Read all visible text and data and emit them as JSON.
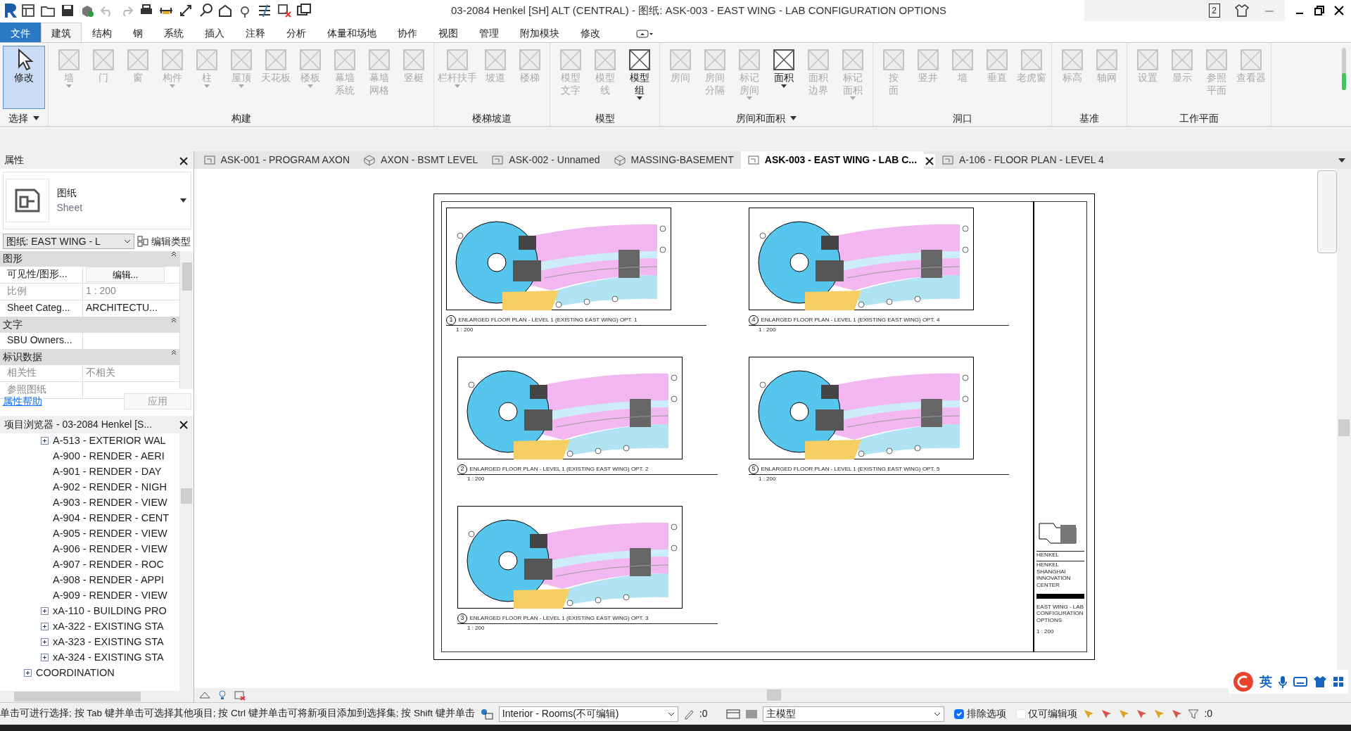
{
  "title_bar": {
    "title": "03-2084 Henkel [SH] ALT (CENTRAL) - 图纸: ASK-003 - EAST WING - LAB CONFIGURATION OPTIONS",
    "badge": "2"
  },
  "ribbon_tabs": [
    {
      "label": "文件",
      "kind": "file",
      "selected": false
    },
    {
      "label": "建筑",
      "kind": "tab",
      "selected": true
    },
    {
      "label": "结构",
      "kind": "tab",
      "selected": false
    },
    {
      "label": "钢",
      "kind": "tab",
      "selected": false
    },
    {
      "label": "系统",
      "kind": "tab",
      "selected": false
    },
    {
      "label": "插入",
      "kind": "tab",
      "selected": false
    },
    {
      "label": "注释",
      "kind": "tab",
      "selected": false
    },
    {
      "label": "分析",
      "kind": "tab",
      "selected": false
    },
    {
      "label": "体量和场地",
      "kind": "tab",
      "selected": false
    },
    {
      "label": "协作",
      "kind": "tab",
      "selected": false
    },
    {
      "label": "视图",
      "kind": "tab",
      "selected": false
    },
    {
      "label": "管理",
      "kind": "tab",
      "selected": false
    },
    {
      "label": "附加模块",
      "kind": "tab",
      "selected": false
    },
    {
      "label": "修改",
      "kind": "tab",
      "selected": false
    }
  ],
  "ribbon_panels": [
    {
      "label": "选择",
      "menu": true,
      "tools": [
        {
          "label": "修改",
          "wrapped": false,
          "disabled": false,
          "selected": true,
          "dropdown": false
        }
      ]
    },
    {
      "label": "构建",
      "menu": false,
      "tools": [
        {
          "label": "墙",
          "wrapped": false,
          "disabled": true,
          "selected": false,
          "dropdown": true
        },
        {
          "label": "门",
          "wrapped": false,
          "disabled": true,
          "selected": false,
          "dropdown": false
        },
        {
          "label": "窗",
          "wrapped": false,
          "disabled": true,
          "selected": false,
          "dropdown": false
        },
        {
          "label": "构件",
          "wrapped": false,
          "disabled": true,
          "selected": false,
          "dropdown": true
        },
        {
          "label": "柱",
          "wrapped": false,
          "disabled": true,
          "selected": false,
          "dropdown": true
        },
        {
          "label": "屋顶",
          "wrapped": false,
          "disabled": true,
          "selected": false,
          "dropdown": true
        },
        {
          "label": "天花板",
          "wrapped": false,
          "disabled": true,
          "selected": false,
          "dropdown": false
        },
        {
          "label": "楼板",
          "wrapped": false,
          "disabled": true,
          "selected": false,
          "dropdown": true
        },
        {
          "label": "幕墙系统",
          "wrapped": true,
          "disabled": true,
          "selected": false,
          "dropdown": false
        },
        {
          "label": "幕墙网格",
          "wrapped": true,
          "disabled": true,
          "selected": false,
          "dropdown": false
        },
        {
          "label": "竖梃",
          "wrapped": false,
          "disabled": true,
          "selected": false,
          "dropdown": false
        }
      ]
    },
    {
      "label": "楼梯坡道",
      "menu": false,
      "tools": [
        {
          "label": "栏杆扶手",
          "wrapped": false,
          "disabled": true,
          "selected": false,
          "dropdown": true
        },
        {
          "label": "坡道",
          "wrapped": false,
          "disabled": true,
          "selected": false,
          "dropdown": false
        },
        {
          "label": "楼梯",
          "wrapped": false,
          "disabled": true,
          "selected": false,
          "dropdown": false
        }
      ]
    },
    {
      "label": "模型",
      "menu": false,
      "tools": [
        {
          "label": "模型文字",
          "wrapped": true,
          "disabled": true,
          "selected": false,
          "dropdown": false
        },
        {
          "label": "模型线",
          "wrapped": true,
          "disabled": true,
          "selected": false,
          "dropdown": false
        },
        {
          "label": "模型组",
          "wrapped": true,
          "disabled": false,
          "selected": false,
          "dropdown": true
        }
      ]
    },
    {
      "label": "房间和面积",
      "menu": true,
      "tools": [
        {
          "label": "房间",
          "wrapped": false,
          "disabled": true,
          "selected": false,
          "dropdown": false
        },
        {
          "label": "房间分隔",
          "wrapped": true,
          "disabled": true,
          "selected": false,
          "dropdown": false
        },
        {
          "label": "标记房间",
          "wrapped": true,
          "disabled": true,
          "selected": false,
          "dropdown": true
        },
        {
          "label": "面积",
          "wrapped": false,
          "disabled": false,
          "selected": false,
          "dropdown": true
        },
        {
          "label": "面积边界",
          "wrapped": true,
          "disabled": true,
          "selected": false,
          "dropdown": false
        },
        {
          "label": "标记面积",
          "wrapped": true,
          "disabled": true,
          "selected": false,
          "dropdown": true
        }
      ]
    },
    {
      "label": "洞口",
      "menu": false,
      "tools": [
        {
          "label": "按面",
          "wrapped": true,
          "disabled": true,
          "selected": false,
          "dropdown": false
        },
        {
          "label": "竖井",
          "wrapped": false,
          "disabled": true,
          "selected": false,
          "dropdown": false
        },
        {
          "label": "墙",
          "wrapped": false,
          "disabled": true,
          "selected": false,
          "dropdown": false
        },
        {
          "label": "垂直",
          "wrapped": false,
          "disabled": true,
          "selected": false,
          "dropdown": false
        },
        {
          "label": "老虎窗",
          "wrapped": false,
          "disabled": true,
          "selected": false,
          "dropdown": false
        }
      ]
    },
    {
      "label": "基准",
      "menu": false,
      "tools": [
        {
          "label": "标高",
          "wrapped": false,
          "disabled": true,
          "selected": false,
          "dropdown": false
        },
        {
          "label": "轴网",
          "wrapped": false,
          "disabled": true,
          "selected": false,
          "dropdown": false
        }
      ]
    },
    {
      "label": "工作平面",
      "menu": false,
      "tools": [
        {
          "label": "设置",
          "wrapped": false,
          "disabled": true,
          "selected": false,
          "dropdown": false
        },
        {
          "label": "显示",
          "wrapped": false,
          "disabled": true,
          "selected": false,
          "dropdown": false
        },
        {
          "label": "参照平面",
          "wrapped": true,
          "disabled": true,
          "selected": false,
          "dropdown": false
        },
        {
          "label": "查看器",
          "wrapped": false,
          "disabled": true,
          "selected": false,
          "dropdown": false
        }
      ]
    }
  ],
  "doc_tabs": [
    {
      "label": "ASK-001 - PROGRAM AXON",
      "kind": "sheet",
      "selected": false
    },
    {
      "label": "AXON - BSMT LEVEL",
      "kind": "model",
      "selected": false
    },
    {
      "label": "ASK-002 - Unnamed",
      "kind": "sheet",
      "selected": false
    },
    {
      "label": "MASSING-BASEMENT",
      "kind": "model",
      "selected": false
    },
    {
      "label": "ASK-003 - EAST WING - LAB C...",
      "kind": "sheet",
      "selected": true
    },
    {
      "label": "A-106 - FLOOR PLAN - LEVEL 4",
      "kind": "sheet",
      "selected": false
    }
  ],
  "properties": {
    "title": "属性",
    "type_name": "图纸",
    "type_sub": "Sheet",
    "instance": "图纸: EAST WING - L",
    "edit_type": "编辑类型",
    "groups": [
      {
        "label": "图形",
        "rows": [
          {
            "name": "可见性/图形...",
            "value": "编辑...",
            "kind": "button",
            "disabled": false
          },
          {
            "name": "比例",
            "value": "1 : 200",
            "kind": "text",
            "disabled": true
          },
          {
            "name": "Sheet Categ...",
            "value": "ARCHITECTU...",
            "kind": "text",
            "disabled": false
          }
        ]
      },
      {
        "label": "文字",
        "rows": [
          {
            "name": "SBU Owners...",
            "kind": "text",
            "disabled": false
          }
        ]
      },
      {
        "label": "标识数据",
        "rows": [
          {
            "name": "相关性",
            "value": "不相关",
            "kind": "text",
            "disabled": true
          },
          {
            "name": "参照图纸",
            "kind": "text",
            "disabled": true
          }
        ]
      }
    ],
    "help_link": "属性帮助",
    "apply": "应用"
  },
  "browser": {
    "title": "项目浏览器 - 03-2084 Henkel [S...",
    "items": [
      {
        "label": "A-513 - EXTERIOR WAL",
        "expandable": true
      },
      {
        "label": "A-900 - RENDER - AERI",
        "expandable": false
      },
      {
        "label": "A-901 - RENDER - DAY",
        "expandable": false
      },
      {
        "label": "A-902 - RENDER - NIGH",
        "expandable": false
      },
      {
        "label": "A-903 - RENDER - VIEW",
        "expandable": false
      },
      {
        "label": "A-904 - RENDER - CENT",
        "expandable": false
      },
      {
        "label": "A-905 - RENDER - VIEW",
        "expandable": false
      },
      {
        "label": "A-906 - RENDER - VIEW",
        "expandable": false
      },
      {
        "label": "A-907 - RENDER - ROC",
        "expandable": false
      },
      {
        "label": "A-908 - RENDER - APPI",
        "expandable": false
      },
      {
        "label": "A-909 - RENDER - VIEW",
        "expandable": false
      },
      {
        "label": "xA-110 - BUILDING PRO",
        "expandable": true
      },
      {
        "label": "xA-322 - EXISTING STA",
        "expandable": true
      },
      {
        "label": "xA-323 - EXISTING STA",
        "expandable": true
      },
      {
        "label": "xA-324 - EXISTING STA",
        "expandable": true
      }
    ],
    "groups_below": [
      {
        "label": "COORDINATION",
        "expandable": true
      }
    ]
  },
  "sheet": {
    "views": [
      {
        "caption": "ENLARGED FLOOR PLAN - LEVEL 1 (EXISTING EAST WING) OPT. 1",
        "number": "1",
        "scale": "1 : 200"
      },
      {
        "caption": "ENLARGED FLOOR PLAN - LEVEL 1 (EXISTING EAST WING) OPT. 4",
        "number": "4",
        "scale": "1 : 200"
      },
      {
        "caption": "ENLARGED FLOOR PLAN - LEVEL 1 (EXISTING EAST WING) OPT. 2",
        "number": "2",
        "scale": "1 : 200"
      },
      {
        "caption": "ENLARGED FLOOR PLAN - LEVEL 1 (EXISTING EAST WING) OPT. 5",
        "number": "5",
        "scale": "1 : 200"
      },
      {
        "caption": "ENLARGED FLOOR PLAN - LEVEL 1 (EXISTING EAST WING) OPT. 3",
        "number": "3",
        "scale": "1 : 200"
      }
    ],
    "title_block": {
      "client": "HENKEL",
      "project": "HENKEL SHANGHAI INNOVATION CENTER",
      "drawing_title": "EAST WING - LAB CONFIGURATION OPTIONS",
      "scale": "1 : 200"
    }
  },
  "ime_bar": {
    "mode": "英"
  },
  "status_bar": {
    "message": "单击可进行选择; 按 Tab 键并单击可选择其他项目; 按 Ctrl 键并单击可将新项目添加到选择集; 按 Shift 键并单击",
    "workset": "Interior - Rooms(不可编辑)",
    "editable_count": ":0",
    "design_option": "主模型",
    "checkboxes": [
      {
        "label": "排除选项",
        "checked": true
      },
      {
        "label": "仅可编辑项",
        "checked": false
      }
    ],
    "filter_count": ":0"
  }
}
